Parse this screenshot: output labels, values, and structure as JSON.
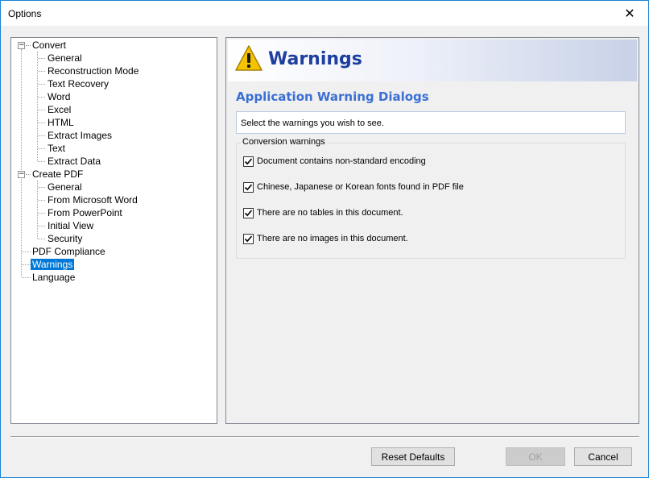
{
  "window": {
    "title": "Options",
    "close_glyph": "✕"
  },
  "tree": {
    "convert": {
      "label": "Convert",
      "children": [
        "General",
        "Reconstruction Mode",
        "Text Recovery",
        "Word",
        "Excel",
        "HTML",
        "Extract Images",
        "Text",
        "Extract Data"
      ]
    },
    "create_pdf": {
      "label": "Create PDF",
      "children": [
        "General",
        "From Microsoft Word",
        "From PowerPoint",
        "Initial View",
        "Security"
      ]
    },
    "pdf_compliance": "PDF Compliance",
    "warnings": "Warnings",
    "language": "Language",
    "expander_glyph": "−",
    "selected": "Warnings"
  },
  "panel": {
    "banner_title": "Warnings",
    "banner_icon": "warning-triangle-icon",
    "section_title": "Application Warning Dialogs",
    "info_text": "Select the warnings you wish to see.",
    "group_label": "Conversion warnings",
    "warnings": [
      {
        "label": "Document contains non-standard encoding",
        "checked": true
      },
      {
        "label": "Chinese, Japanese or Korean fonts found in PDF file",
        "checked": true
      },
      {
        "label": "There are no tables in this document.",
        "checked": true
      },
      {
        "label": "There are no images in this document.",
        "checked": true
      }
    ]
  },
  "buttons": {
    "reset": "Reset Defaults",
    "ok": "OK",
    "cancel": "Cancel"
  },
  "colors": {
    "accent": "#0078d7",
    "banner_title": "#1e3fa0",
    "section_title": "#3b6fd4"
  }
}
